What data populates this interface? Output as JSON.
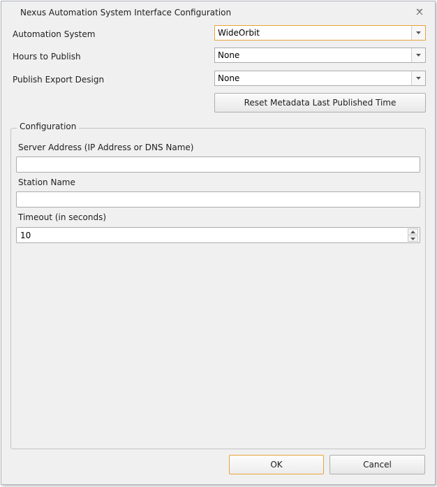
{
  "window": {
    "title": "Nexus Automation System Interface Configuration"
  },
  "form": {
    "automation_system": {
      "label": "Automation System",
      "value": "WideOrbit"
    },
    "hours_to_publish": {
      "label": "Hours to Publish",
      "value": "None"
    },
    "publish_export_design": {
      "label": "Publish Export Design",
      "value": "None"
    },
    "reset_button": "Reset Metadata Last Published Time"
  },
  "configuration": {
    "legend": "Configuration",
    "server_address": {
      "label": "Server Address (IP Address or DNS Name)",
      "value": ""
    },
    "station_name": {
      "label": "Station Name",
      "value": ""
    },
    "timeout": {
      "label": "Timeout (in seconds)",
      "value": "10"
    }
  },
  "buttons": {
    "ok": "OK",
    "cancel": "Cancel"
  },
  "icons": {
    "close": "close-icon",
    "dropdown": "chevron-down-icon",
    "spin_up": "caret-up-icon",
    "spin_down": "caret-down-icon"
  },
  "colors": {
    "focus_accent": "#e8a43b",
    "window_bg": "#f0f0f0"
  }
}
